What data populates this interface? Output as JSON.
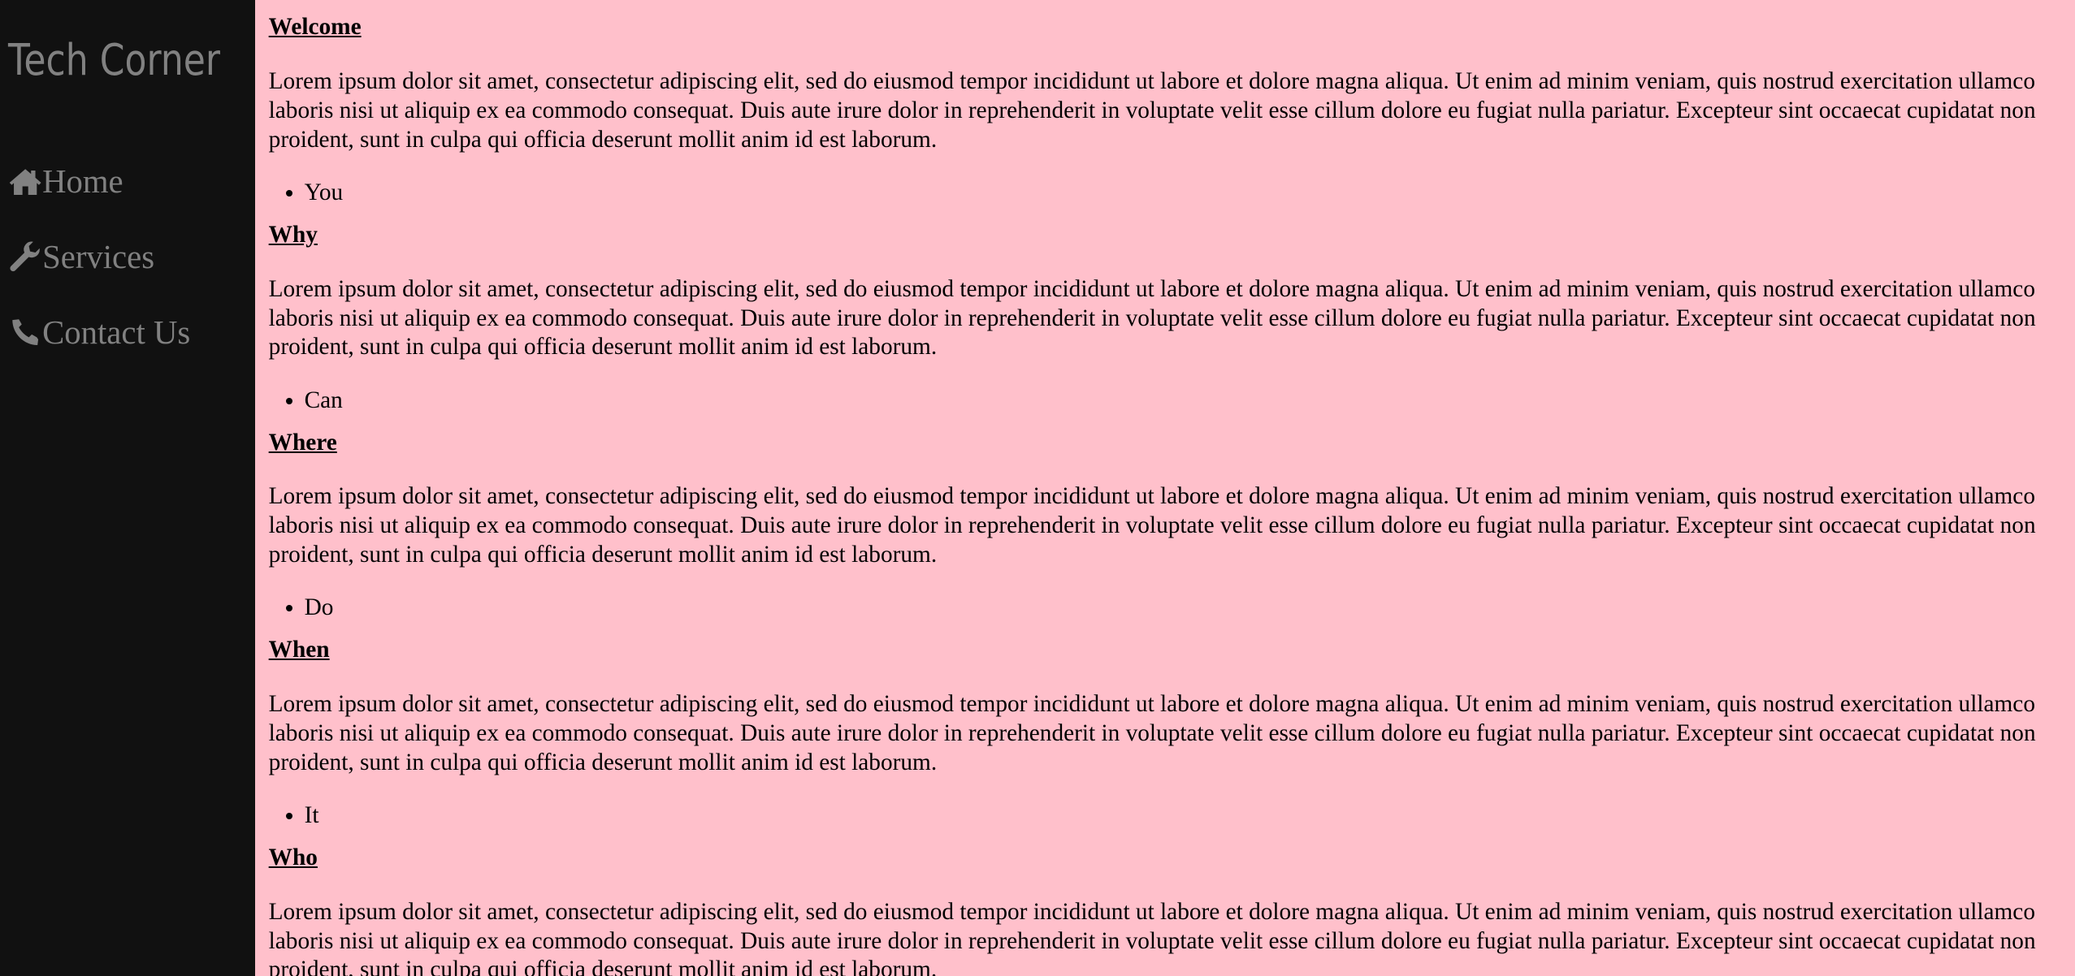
{
  "sidebar": {
    "brand": "Tech Corner",
    "nav": [
      {
        "label": "Home",
        "icon": "home-icon"
      },
      {
        "label": "Services",
        "icon": "wrench-icon"
      },
      {
        "label": "Contact Us",
        "icon": "phone-icon"
      }
    ]
  },
  "main": {
    "lorem": "Lorem ipsum dolor sit amet, consectetur adipiscing elit, sed do eiusmod tempor incididunt ut labore et dolore magna aliqua. Ut enim ad minim veniam, quis nostrud exercitation ullamco laboris nisi ut aliquip ex ea commodo consequat. Duis aute irure dolor in reprehenderit in voluptate velit esse cillum dolore eu fugiat nulla pariatur. Excepteur sint occaecat cupidatat non proident, sunt in culpa qui officia deserunt mollit anim id est laborum.",
    "sections": [
      {
        "heading": "Welcome",
        "item": "You"
      },
      {
        "heading": "Why",
        "item": "Can"
      },
      {
        "heading": "Where",
        "item": "Do"
      },
      {
        "heading": "When",
        "item": "It"
      },
      {
        "heading": "Who"
      }
    ]
  },
  "colors": {
    "sidebar": "#111111",
    "nav_text": "#818181",
    "background": "#ffc0cb"
  }
}
